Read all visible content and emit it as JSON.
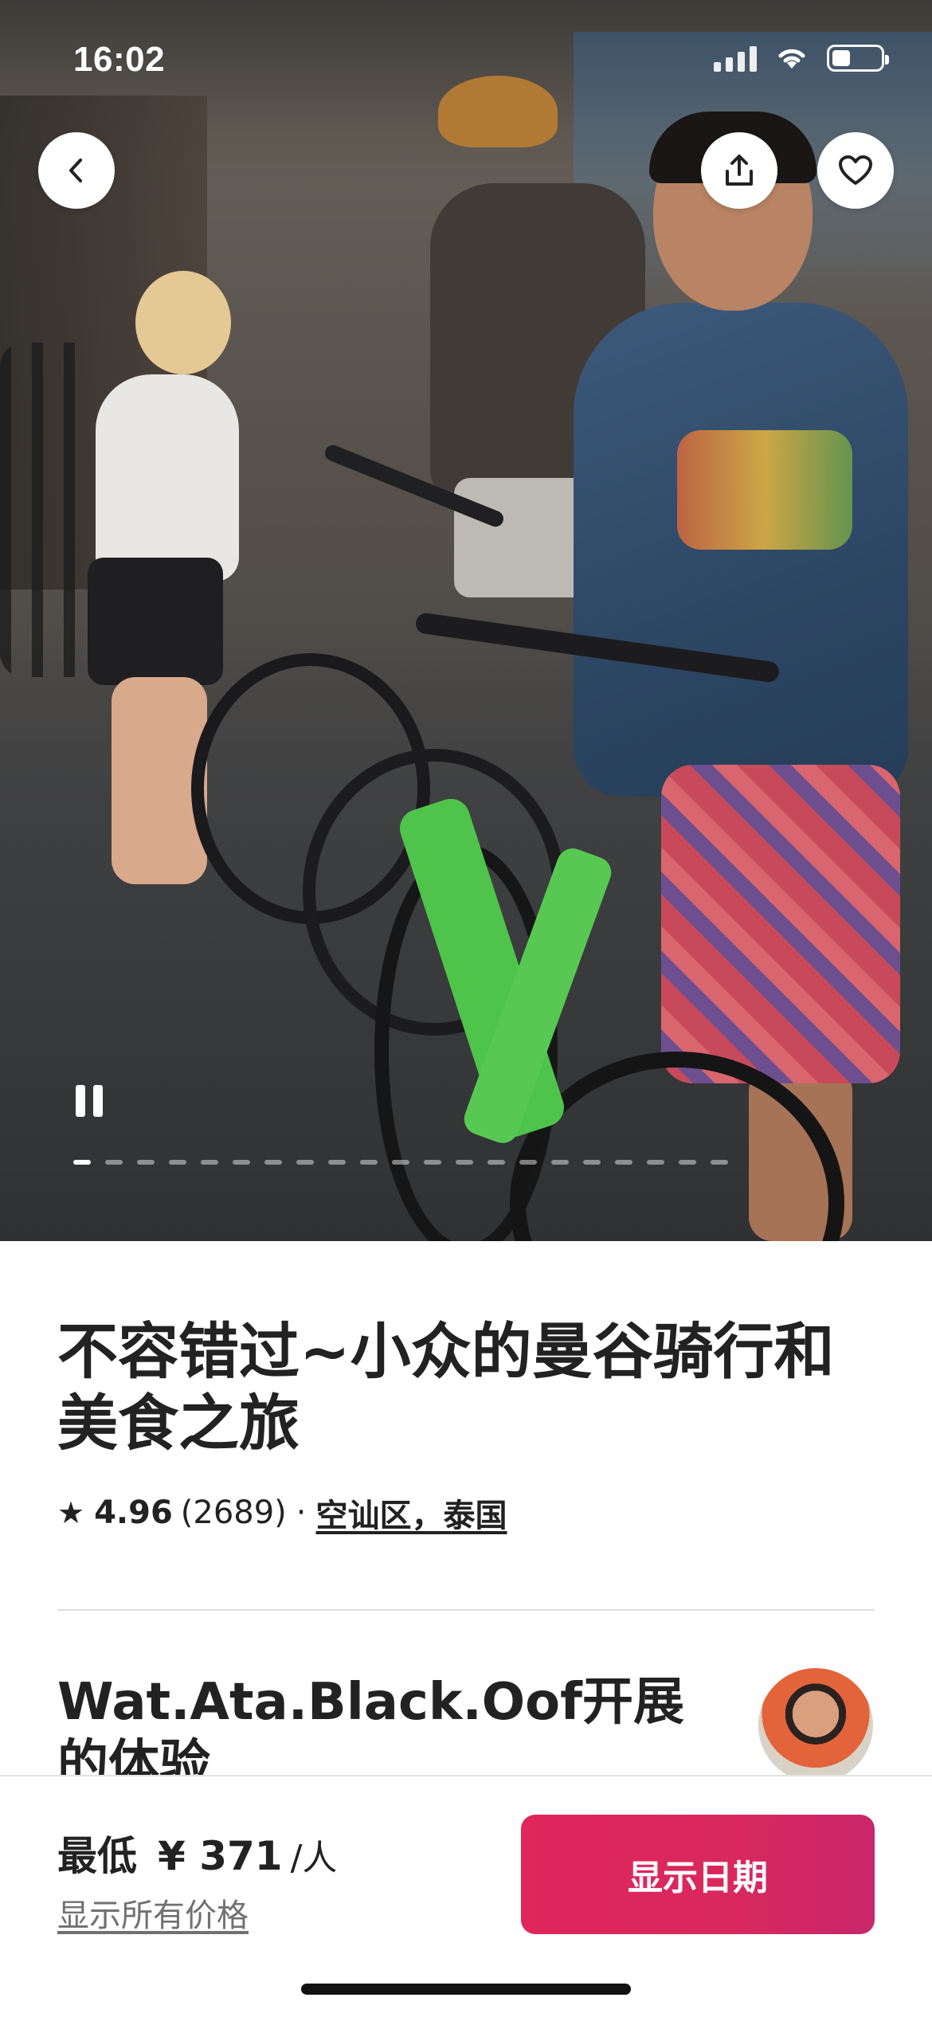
{
  "status_bar": {
    "time": "16:02"
  },
  "hero": {
    "icons": {
      "back": "chevron-left-icon",
      "share": "share-icon",
      "favorite": "heart-icon",
      "pause": "pause-icon"
    },
    "slide_count": 21,
    "active_slide": 1
  },
  "listing": {
    "title": "不容错过~小众的曼谷骑行和美食之旅",
    "rating": "4.96",
    "review_count": "(2689)",
    "separator": "·",
    "location": "空讪区，泰国"
  },
  "host": {
    "title": "Wat.Ata.Black.Oof开展的体验"
  },
  "booking": {
    "from_label": "最低",
    "price": "¥ 371",
    "unit": "/人",
    "all_prices_link": "显示所有价格",
    "cta_label": "显示日期"
  },
  "colors": {
    "accent": "#E0265B",
    "text": "#222222",
    "secondary_text": "#717171"
  }
}
